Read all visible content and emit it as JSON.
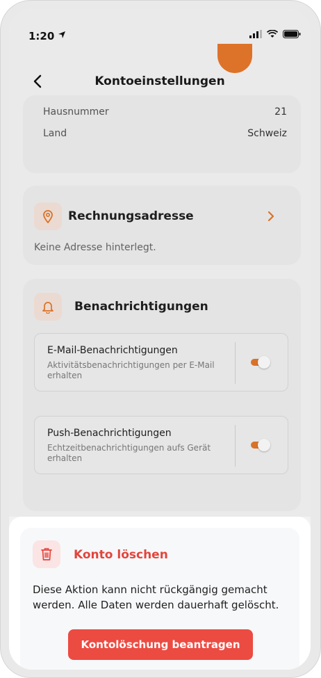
{
  "status_bar": {
    "time": "1:20"
  },
  "nav": {
    "title": "Kontoeinstellungen",
    "back_icon": "chevron-left-icon"
  },
  "address": {
    "rows": [
      {
        "label": "Hausnummer",
        "value": "21"
      },
      {
        "label": "Land",
        "value": "Schweiz"
      }
    ]
  },
  "billing": {
    "title": "Rechnungsadresse",
    "icon": "location-pin-icon",
    "empty_text": "Keine Adresse hinterlegt."
  },
  "notifications": {
    "title": "Benachrichtigungen",
    "icon": "bell-icon",
    "items": [
      {
        "title": "E-Mail-Benachrichtigungen",
        "subtitle": "Aktivitätsbenachrichtigungen per E-Mail erhalten",
        "enabled": true
      },
      {
        "title": "Push-Benachrichtigungen",
        "subtitle": "Echtzeitbenachrichtigungen aufs Gerät erhalten",
        "enabled": true
      }
    ]
  },
  "delete_account": {
    "title": "Konto löschen",
    "icon": "trash-icon",
    "description": "Diese Aktion kann nicht rückgängig gemacht werden. Alle Daten werden dauerhaft gelöscht.",
    "button_label": "Kontolöschung beantragen"
  },
  "colors": {
    "accent": "#e0762b",
    "danger": "#ec4b42",
    "danger_text": "#e2453c",
    "background": "#f2f2f2"
  }
}
